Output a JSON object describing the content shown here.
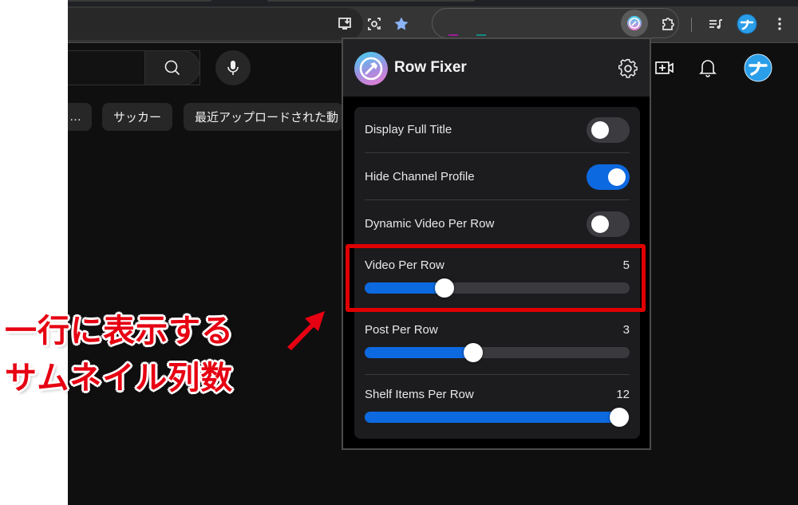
{
  "browser": {
    "toolbar_icons": [
      "install-app-icon",
      "google-lens-icon",
      "bookmark-star-icon"
    ],
    "extensions": [
      "row-fixer-extension-icon",
      "extensions-puzzle-icon"
    ],
    "right_icons": [
      "media-controls-icon",
      "profile-avatar",
      "more-menu-icon"
    ],
    "accent_color": "#8ab4f8"
  },
  "youtube": {
    "chips": [
      "…",
      "サッカー",
      "最近アップロードされた動"
    ],
    "header_icons": [
      "create-video-icon",
      "notifications-bell-icon",
      "account-avatar"
    ]
  },
  "popup": {
    "title": "Row Fixer",
    "settings_icon": "gear-icon",
    "toggles": [
      {
        "label": "Display Full Title",
        "on": false
      },
      {
        "label": "Hide Channel Profile",
        "on": true
      },
      {
        "label": "Dynamic Video Per Row",
        "on": false
      }
    ],
    "sliders": [
      {
        "label": "Video Per Row",
        "value": "5",
        "fraction": 0.3
      },
      {
        "label": "Post Per Row",
        "value": "3",
        "fraction": 0.41
      },
      {
        "label": "Shelf Items Per Row",
        "value": "12",
        "fraction": 0.96
      }
    ],
    "accent_color": "#0d69e0"
  },
  "annotation": {
    "line1": "一行に表示する",
    "line2": "サムネイル列数",
    "color": "#e60012"
  }
}
